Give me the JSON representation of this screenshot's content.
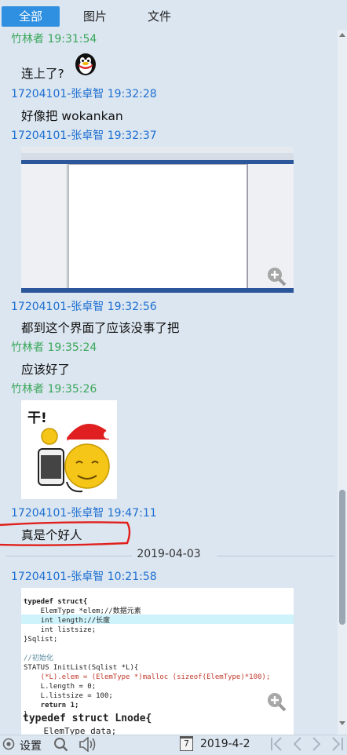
{
  "tabs": [
    {
      "label": "全部",
      "active": true
    },
    {
      "label": "图片",
      "active": false
    },
    {
      "label": "文件",
      "active": false
    }
  ],
  "messages": [
    {
      "sender": "竹林者",
      "time": "19:31:54",
      "text": "连上了?"
    },
    {
      "sender": "17204101-张卓智",
      "time": "19:32:28",
      "text": "好像把  wokankan"
    },
    {
      "sender": "17204101-张卓智",
      "time": "19:32:37"
    },
    {
      "sender": "17204101-张卓智",
      "time": "19:32:56",
      "text": "都到这个界面了应该没事了把"
    },
    {
      "sender": "竹林者",
      "time": "19:35:24",
      "text": "应该好了"
    },
    {
      "sender": "竹林者",
      "time": "19:35:26"
    },
    {
      "sender": "17204101-张卓智",
      "time": "19:47:11",
      "text": "真是个好人"
    },
    {
      "sender": "17204101-张卓智",
      "time": "10:21:58"
    }
  ],
  "date_separator": "2019-04-03",
  "sticker_text": "干!",
  "code_image": {
    "lines": [
      "typedef struct{",
      "    ElemType *elem;//数据元素",
      "    int length;//长度",
      "    int listsize;",
      "}Sqlist;",
      "",
      "//初始化",
      "STATUS InitList(Sqlist *L){",
      "    (*L).elem = (ElemType *)malloc (sizeof(ElemType)*100);",
      "    L.length = 0;",
      "    L.listsize = 100;",
      "    return 1;",
      "}"
    ],
    "big_line": "typedef struct Lnode{",
    "last_line": "    ElemType data;"
  },
  "bottom": {
    "settings_label": "设置",
    "date": "2019-4-2",
    "calendar_day": "7"
  },
  "colors": {
    "accent": "#2f8fe0",
    "sender_blue": "#1d6fd1",
    "sender_green": "#3aa65a",
    "highlight_red": "#e0201c"
  }
}
